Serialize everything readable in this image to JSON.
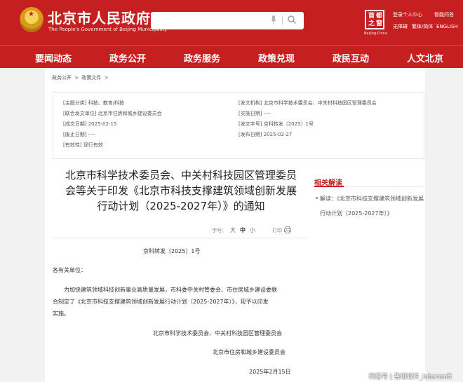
{
  "header": {
    "site_title": "北京市人民政府",
    "site_subtitle": "The People's Government of Beijing Municipality",
    "seal_chars": [
      "首",
      "都",
      "之",
      "窗"
    ],
    "seal_caption": "Beijing·China",
    "login": "登录个人中心",
    "accessibility": "无障碍",
    "trad_simp": "繁体/简体",
    "smart_q": "智能问答",
    "english": "ENGLISH"
  },
  "nav": {
    "items": [
      "要闻动态",
      "政务公开",
      "政务服务",
      "政策兑现",
      "政民互动",
      "人文北京"
    ]
  },
  "breadcrumb": [
    "政务公开",
    "政策文件"
  ],
  "breadcrumb_seps": [
    ">",
    ">"
  ],
  "meta": {
    "topic_label": "[主题分类]",
    "topic_value": "科技、教育/科技",
    "issuer_label": "[发文机构]",
    "issuer_value": "北京市科学技术委员会、中关村科技园区管理委员会",
    "joint_label": "[联合发文单位]",
    "joint_value": "北京市住房和城乡建设委员会",
    "effective_label": "[实施日期]",
    "effective_value": "----",
    "created_label": "[成文日期]",
    "created_value": "2025-02-15",
    "docno_label": "[发文字号]",
    "docno_value": "京科转发〔2025〕1号",
    "repeal_label": "[废止日期]",
    "repeal_value": "----",
    "published_label": "[发布日期]",
    "published_value": "2025-02-27",
    "validity_label": "[有效性]",
    "validity_value": "现行有效"
  },
  "document": {
    "title_line1": "北京市科学技术委员会、中关村科技园区管理委员",
    "title_line2": "会等关于印发《北京市科技支撑建筑领域创新发展",
    "title_line3": "行动计划（2025-2027年）》的通知",
    "font_label": "字号：",
    "size_large": "大",
    "size_medium": "中",
    "size_small": "小",
    "print_label": "打印",
    "doc_number": "京科转发〔2025〕1号",
    "salutation": "各有关单位：",
    "para_line1": "为加快建筑领域科技创新事业高质量发展，市科委中关村管委会、市住房城乡建设委联",
    "para_line2": "合制定了《北京市科技支撑建筑领域创新发展行动计划（2025-2027年）》，现予以印发",
    "para_line3": "实施。",
    "signer1": "北京市科学技术委员会、中关村科技园区管理委员会",
    "signer2": "北京市住房和城乡建设委员会",
    "sign_date": "2025年2月15日"
  },
  "sidebar": {
    "title": "相关解读",
    "item": "解读：《北京市科技支撑建筑领域创新发展行动计划（2025-2027年）》"
  },
  "watermark": "网易号 | 鲁班软件_lubansoft",
  "colors": {
    "brand_red": "#c51f1f",
    "page_gray": "#f2f2f2"
  }
}
